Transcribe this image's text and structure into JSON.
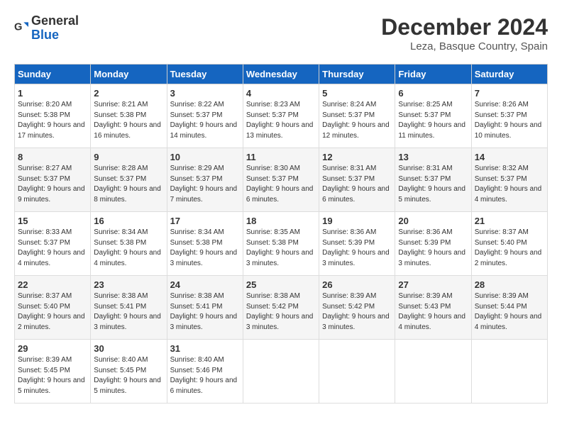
{
  "header": {
    "logo_general": "General",
    "logo_blue": "Blue",
    "month_title": "December 2024",
    "location": "Leza, Basque Country, Spain"
  },
  "weekdays": [
    "Sunday",
    "Monday",
    "Tuesday",
    "Wednesday",
    "Thursday",
    "Friday",
    "Saturday"
  ],
  "weeks": [
    [
      {
        "day": "1",
        "sunrise": "8:20 AM",
        "sunset": "5:38 PM",
        "daylight": "9 hours and 17 minutes."
      },
      {
        "day": "2",
        "sunrise": "8:21 AM",
        "sunset": "5:38 PM",
        "daylight": "9 hours and 16 minutes."
      },
      {
        "day": "3",
        "sunrise": "8:22 AM",
        "sunset": "5:37 PM",
        "daylight": "9 hours and 14 minutes."
      },
      {
        "day": "4",
        "sunrise": "8:23 AM",
        "sunset": "5:37 PM",
        "daylight": "9 hours and 13 minutes."
      },
      {
        "day": "5",
        "sunrise": "8:24 AM",
        "sunset": "5:37 PM",
        "daylight": "9 hours and 12 minutes."
      },
      {
        "day": "6",
        "sunrise": "8:25 AM",
        "sunset": "5:37 PM",
        "daylight": "9 hours and 11 minutes."
      },
      {
        "day": "7",
        "sunrise": "8:26 AM",
        "sunset": "5:37 PM",
        "daylight": "9 hours and 10 minutes."
      }
    ],
    [
      {
        "day": "8",
        "sunrise": "8:27 AM",
        "sunset": "5:37 PM",
        "daylight": "9 hours and 9 minutes."
      },
      {
        "day": "9",
        "sunrise": "8:28 AM",
        "sunset": "5:37 PM",
        "daylight": "9 hours and 8 minutes."
      },
      {
        "day": "10",
        "sunrise": "8:29 AM",
        "sunset": "5:37 PM",
        "daylight": "9 hours and 7 minutes."
      },
      {
        "day": "11",
        "sunrise": "8:30 AM",
        "sunset": "5:37 PM",
        "daylight": "9 hours and 6 minutes."
      },
      {
        "day": "12",
        "sunrise": "8:31 AM",
        "sunset": "5:37 PM",
        "daylight": "9 hours and 6 minutes."
      },
      {
        "day": "13",
        "sunrise": "8:31 AM",
        "sunset": "5:37 PM",
        "daylight": "9 hours and 5 minutes."
      },
      {
        "day": "14",
        "sunrise": "8:32 AM",
        "sunset": "5:37 PM",
        "daylight": "9 hours and 4 minutes."
      }
    ],
    [
      {
        "day": "15",
        "sunrise": "8:33 AM",
        "sunset": "5:37 PM",
        "daylight": "9 hours and 4 minutes."
      },
      {
        "day": "16",
        "sunrise": "8:34 AM",
        "sunset": "5:38 PM",
        "daylight": "9 hours and 4 minutes."
      },
      {
        "day": "17",
        "sunrise": "8:34 AM",
        "sunset": "5:38 PM",
        "daylight": "9 hours and 3 minutes."
      },
      {
        "day": "18",
        "sunrise": "8:35 AM",
        "sunset": "5:38 PM",
        "daylight": "9 hours and 3 minutes."
      },
      {
        "day": "19",
        "sunrise": "8:36 AM",
        "sunset": "5:39 PM",
        "daylight": "9 hours and 3 minutes."
      },
      {
        "day": "20",
        "sunrise": "8:36 AM",
        "sunset": "5:39 PM",
        "daylight": "9 hours and 3 minutes."
      },
      {
        "day": "21",
        "sunrise": "8:37 AM",
        "sunset": "5:40 PM",
        "daylight": "9 hours and 2 minutes."
      }
    ],
    [
      {
        "day": "22",
        "sunrise": "8:37 AM",
        "sunset": "5:40 PM",
        "daylight": "9 hours and 2 minutes."
      },
      {
        "day": "23",
        "sunrise": "8:38 AM",
        "sunset": "5:41 PM",
        "daylight": "9 hours and 3 minutes."
      },
      {
        "day": "24",
        "sunrise": "8:38 AM",
        "sunset": "5:41 PM",
        "daylight": "9 hours and 3 minutes."
      },
      {
        "day": "25",
        "sunrise": "8:38 AM",
        "sunset": "5:42 PM",
        "daylight": "9 hours and 3 minutes."
      },
      {
        "day": "26",
        "sunrise": "8:39 AM",
        "sunset": "5:42 PM",
        "daylight": "9 hours and 3 minutes."
      },
      {
        "day": "27",
        "sunrise": "8:39 AM",
        "sunset": "5:43 PM",
        "daylight": "9 hours and 4 minutes."
      },
      {
        "day": "28",
        "sunrise": "8:39 AM",
        "sunset": "5:44 PM",
        "daylight": "9 hours and 4 minutes."
      }
    ],
    [
      {
        "day": "29",
        "sunrise": "8:39 AM",
        "sunset": "5:45 PM",
        "daylight": "9 hours and 5 minutes."
      },
      {
        "day": "30",
        "sunrise": "8:40 AM",
        "sunset": "5:45 PM",
        "daylight": "9 hours and 5 minutes."
      },
      {
        "day": "31",
        "sunrise": "8:40 AM",
        "sunset": "5:46 PM",
        "daylight": "9 hours and 6 minutes."
      },
      null,
      null,
      null,
      null
    ]
  ],
  "labels": {
    "sunrise": "Sunrise:",
    "sunset": "Sunset:",
    "daylight": "Daylight:"
  }
}
